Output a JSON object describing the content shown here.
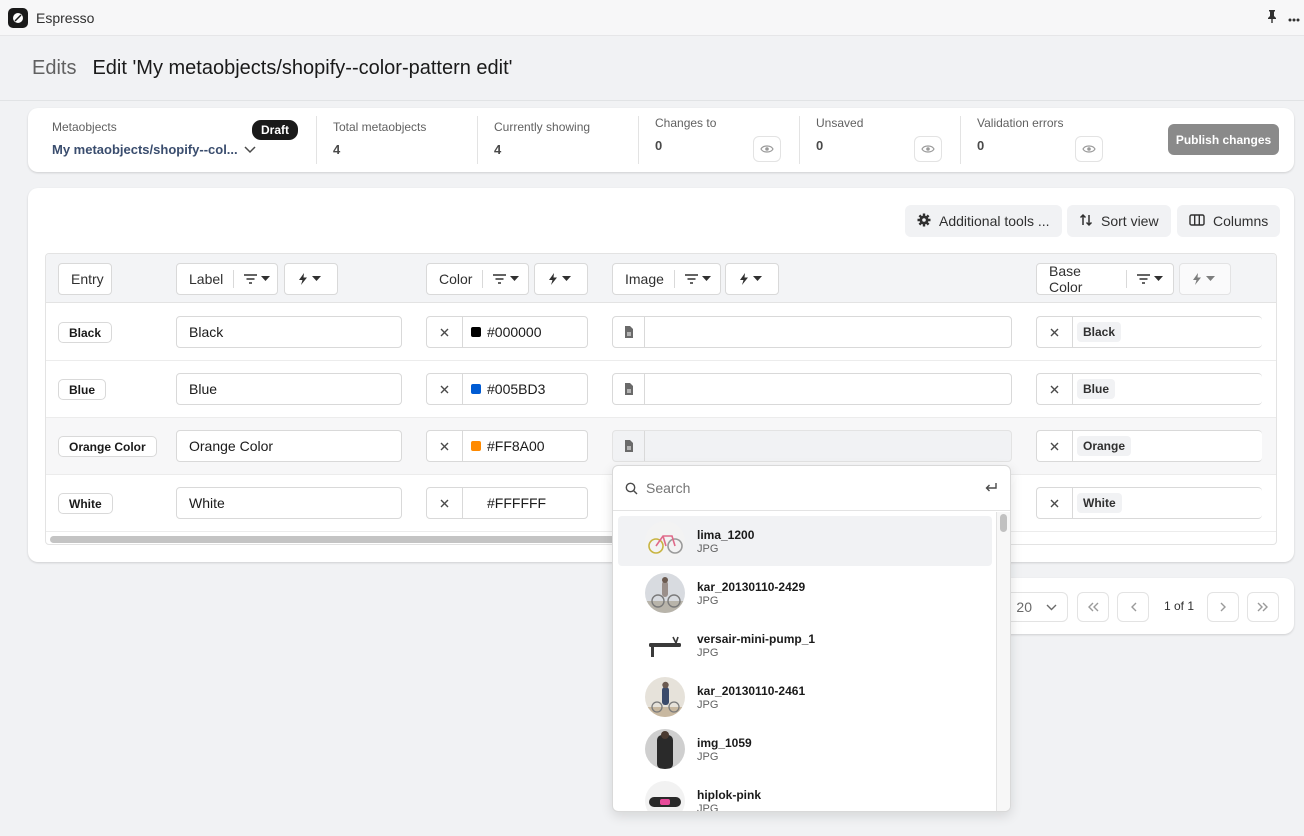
{
  "app": {
    "title": "Espresso"
  },
  "header": {
    "breadcrumb": "Edits",
    "title": "Edit 'My metaobjects/shopify--color-pattern edit'"
  },
  "stats": {
    "metaobjects_label": "Metaobjects",
    "metaobjects_value": "My metaobjects/shopify--col...",
    "draft_badge": "Draft",
    "total_label": "Total metaobjects",
    "total_value": "4",
    "showing_label": "Currently showing",
    "showing_value": "4",
    "changes_label": "Changes to",
    "changes_value": "0",
    "unsaved_label": "Unsaved",
    "unsaved_value": "0",
    "errors_label": "Validation errors",
    "errors_value": "0",
    "publish_label": "Publish changes"
  },
  "toolbar": {
    "additional_tools": "Additional tools ...",
    "sort_view": "Sort view",
    "columns": "Columns"
  },
  "columns": {
    "entry": "Entry",
    "label": "Label",
    "color": "Color",
    "image": "Image",
    "base_color": "Base Color"
  },
  "rows": [
    {
      "entry": "Black",
      "label": "Black",
      "color": "#000000",
      "swatch": "#000000",
      "base": "Black"
    },
    {
      "entry": "Blue",
      "label": "Blue",
      "color": "#005BD3",
      "swatch": "#005BD3",
      "base": "Blue"
    },
    {
      "entry": "Orange Color",
      "label": "Orange Color",
      "color": "#FF8A00",
      "swatch": "#FF8A00",
      "base": "Orange"
    },
    {
      "entry": "White",
      "label": "White",
      "color": "#FFFFFF",
      "swatch": "#FFFFFF",
      "base": "White"
    }
  ],
  "pagination": {
    "page_size": "20",
    "page_info": "1 of 1"
  },
  "dropdown": {
    "search_placeholder": "Search",
    "items": [
      {
        "name": "lima_1200",
        "type": "JPG"
      },
      {
        "name": "kar_20130110-2429",
        "type": "JPG"
      },
      {
        "name": "versair-mini-pump_1",
        "type": "JPG"
      },
      {
        "name": "kar_20130110-2461",
        "type": "JPG"
      },
      {
        "name": "img_1059",
        "type": "JPG"
      },
      {
        "name": "hiplok-pink",
        "type": "JPG"
      }
    ]
  },
  "colors": {
    "accent": "#1a1a1a",
    "publish_disabled": "#8a8a8a"
  }
}
